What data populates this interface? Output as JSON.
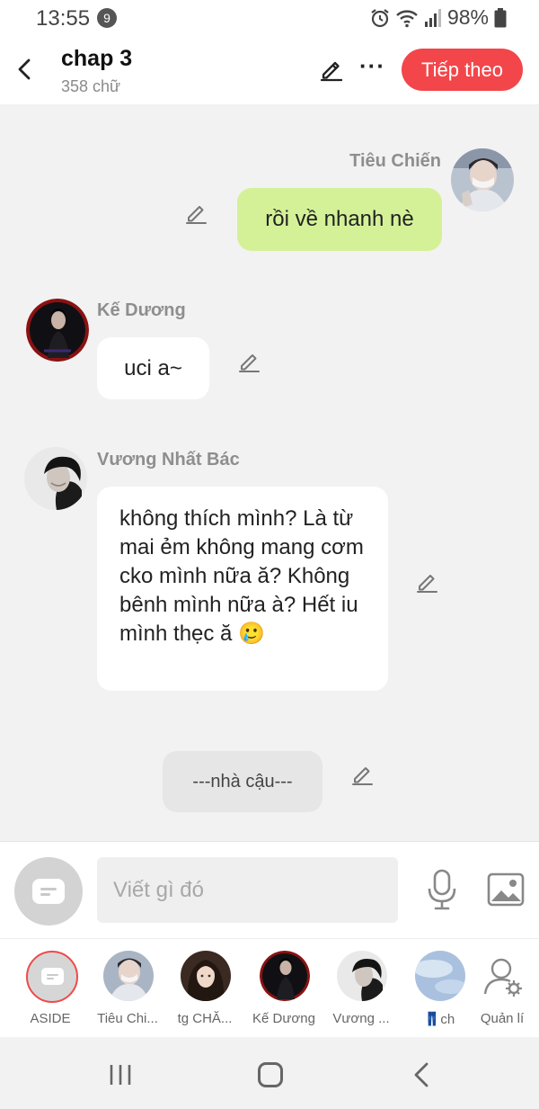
{
  "status_bar": {
    "time": "13:55",
    "notification_count": "9",
    "battery": "98%"
  },
  "header": {
    "title": "chap 3",
    "subtitle": "358 chữ",
    "next_label": "Tiếp theo"
  },
  "messages": [
    {
      "sender": "Tiêu Chiến",
      "text": "rồi về nhanh nè",
      "side": "right",
      "bubble_color": "#d4f198"
    },
    {
      "sender": "Kế Dương",
      "text": "uci a~",
      "side": "left",
      "bubble_color": "#ffffff"
    },
    {
      "sender": "Vương Nhất Bác",
      "text": "không thích mình? Là từ mai ẻm không mang cơm cko mình nữa ă? Không bênh mình nữa à? Hết iu mình thẹc ă 🥲",
      "side": "left",
      "bubble_color": "#ffffff"
    },
    {
      "sender": "",
      "text": "---nhà cậu---",
      "side": "center",
      "bubble_color": "#e6e6e6"
    }
  ],
  "input": {
    "placeholder": "Viết gì đó"
  },
  "characters": [
    {
      "label": "ASIDE"
    },
    {
      "label": "Tiêu Chi..."
    },
    {
      "label": "tg CHĂ..."
    },
    {
      "label": "Kế Dương"
    },
    {
      "label": "Vương ..."
    },
    {
      "label": "👖ch"
    },
    {
      "label": "Quản lí"
    }
  ],
  "colors": {
    "accent": "#f2464b",
    "sent_bubble": "#d4f198",
    "chat_background": "#f2f2f2"
  }
}
